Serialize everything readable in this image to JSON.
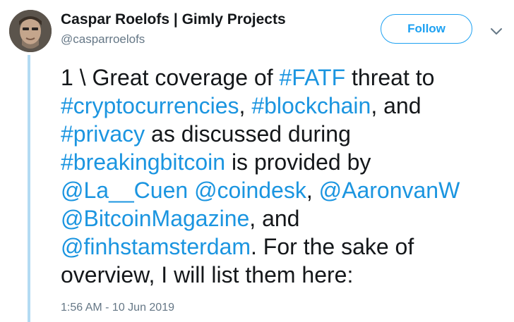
{
  "author": {
    "name": "Caspar Roelofs | Gimly Projects",
    "handle": "@casparroelofs"
  },
  "follow_label": "Follow",
  "icons": {
    "avatar": "profile-photo",
    "menu": "chevron-down-icon"
  },
  "colors": {
    "link": "#1b95e0",
    "follow": "#1da1f2",
    "thread_line": "#b3dbf3",
    "secondary_text": "#657786"
  },
  "tweet_lines": [
    [
      {
        "t": "1 \\ Great coverage of ",
        "link": false
      },
      {
        "t": "#FATF",
        "link": true
      },
      {
        "t": " threat to",
        "link": false
      }
    ],
    [
      {
        "t": "#cryptocurrencies",
        "link": true
      },
      {
        "t": ", ",
        "link": false
      },
      {
        "t": "#blockchain",
        "link": true
      },
      {
        "t": ", and",
        "link": false
      }
    ],
    [
      {
        "t": "#privacy",
        "link": true
      },
      {
        "t": " as discussed during",
        "link": false
      }
    ],
    [
      {
        "t": "#breakingbitcoin",
        "link": true
      },
      {
        "t": " is provided by",
        "link": false
      }
    ],
    [
      {
        "t": "@La__Cuen",
        "link": true
      },
      {
        "t": " ",
        "link": false
      },
      {
        "t": "@coindesk",
        "link": true
      },
      {
        "t": ", ",
        "link": false
      },
      {
        "t": "@AaronvanW",
        "link": true
      }
    ],
    [
      {
        "t": "@BitcoinMagazine",
        "link": true
      },
      {
        "t": ", and",
        "link": false
      }
    ],
    [
      {
        "t": "@finhstamsterdam",
        "link": true
      },
      {
        "t": ". For the sake of",
        "link": false
      }
    ],
    [
      {
        "t": "overview, I will list them here:",
        "link": false
      }
    ]
  ],
  "timestamp": "1:56 AM - 10 Jun 2019"
}
